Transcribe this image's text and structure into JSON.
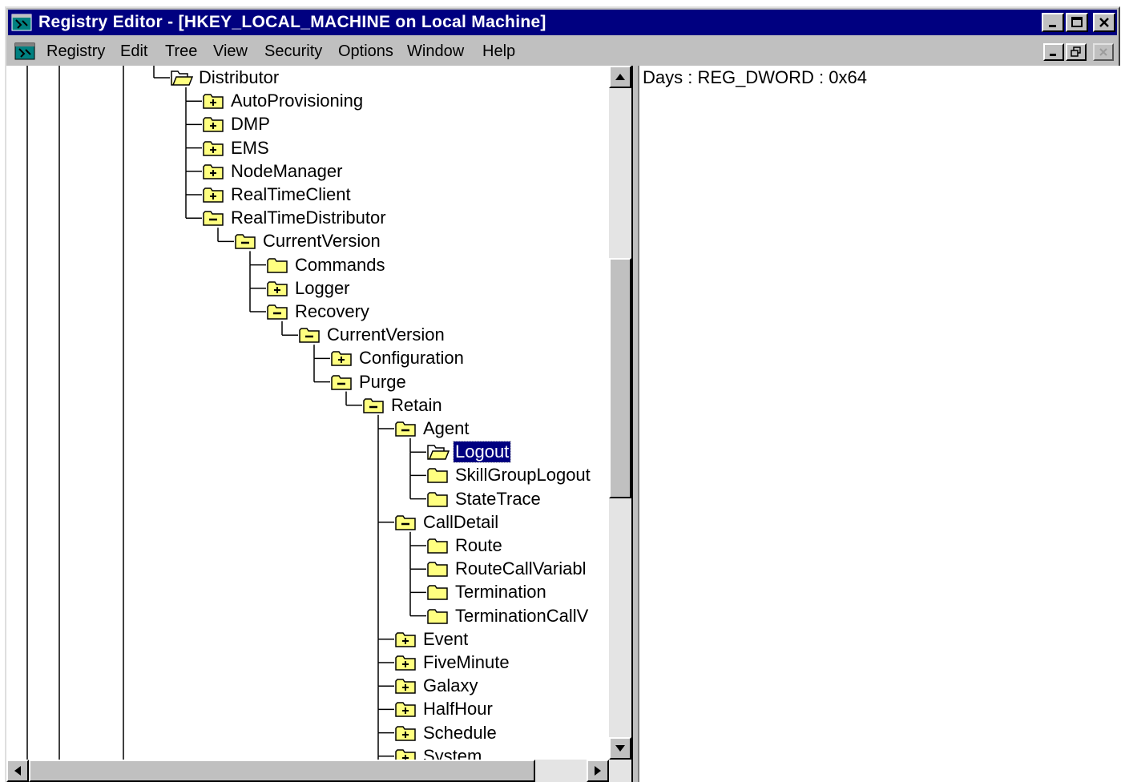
{
  "window": {
    "title": "Registry Editor - [HKEY_LOCAL_MACHINE on Local Machine]"
  },
  "menu": {
    "items": [
      {
        "label": "Registry"
      },
      {
        "label": "Edit"
      },
      {
        "label": "Tree"
      },
      {
        "label": "View"
      },
      {
        "label": "Security"
      },
      {
        "label": "Options"
      },
      {
        "label": "Window"
      },
      {
        "label": "Help"
      }
    ]
  },
  "tree": {
    "nodes": [
      {
        "label": "Distributor",
        "depth": 0,
        "folder": "open",
        "last": true
      },
      {
        "label": "AutoProvisioning",
        "depth": 1,
        "folder": "plus"
      },
      {
        "label": "DMP",
        "depth": 1,
        "folder": "plus"
      },
      {
        "label": "EMS",
        "depth": 1,
        "folder": "plus"
      },
      {
        "label": "NodeManager",
        "depth": 1,
        "folder": "plus"
      },
      {
        "label": "RealTimeClient",
        "depth": 1,
        "folder": "plus"
      },
      {
        "label": "RealTimeDistributor",
        "depth": 1,
        "folder": "minus"
      },
      {
        "label": "CurrentVersion",
        "depth": 2,
        "folder": "minus",
        "last": true
      },
      {
        "label": "Commands",
        "depth": 3,
        "folder": "closed"
      },
      {
        "label": "Logger",
        "depth": 3,
        "folder": "plus"
      },
      {
        "label": "Recovery",
        "depth": 3,
        "folder": "minus",
        "last": true
      },
      {
        "label": "CurrentVersion",
        "depth": 4,
        "folder": "minus",
        "last": true
      },
      {
        "label": "Configuration",
        "depth": 5,
        "folder": "plus"
      },
      {
        "label": "Purge",
        "depth": 5,
        "folder": "minus"
      },
      {
        "label": "Retain",
        "depth": 6,
        "folder": "minus"
      },
      {
        "label": "Agent",
        "depth": 7,
        "folder": "minus"
      },
      {
        "label": "Logout",
        "depth": 8,
        "folder": "open",
        "selected": true
      },
      {
        "label": "SkillGroupLogout",
        "depth": 8,
        "folder": "closed"
      },
      {
        "label": "StateTrace",
        "depth": 8,
        "folder": "closed",
        "last": true
      },
      {
        "label": "CallDetail",
        "depth": 7,
        "folder": "minus"
      },
      {
        "label": "Route",
        "depth": 8,
        "folder": "closed"
      },
      {
        "label": "RouteCallVariabl",
        "depth": 8,
        "folder": "closed"
      },
      {
        "label": "Termination",
        "depth": 8,
        "folder": "closed"
      },
      {
        "label": "TerminationCallV",
        "depth": 8,
        "folder": "closed",
        "last": true
      },
      {
        "label": "Event",
        "depth": 7,
        "folder": "plus"
      },
      {
        "label": "FiveMinute",
        "depth": 7,
        "folder": "plus"
      },
      {
        "label": "Galaxy",
        "depth": 7,
        "folder": "plus"
      },
      {
        "label": "HalfHour",
        "depth": 7,
        "folder": "plus"
      },
      {
        "label": "Schedule",
        "depth": 7,
        "folder": "plus"
      },
      {
        "label": "System",
        "depth": 7,
        "folder": "plus"
      }
    ]
  },
  "values": {
    "entry": "Days : REG_DWORD : 0x64"
  },
  "colors": {
    "title_bg": "#000080",
    "folder_fill": "#ffff80",
    "selection": "#000080"
  }
}
